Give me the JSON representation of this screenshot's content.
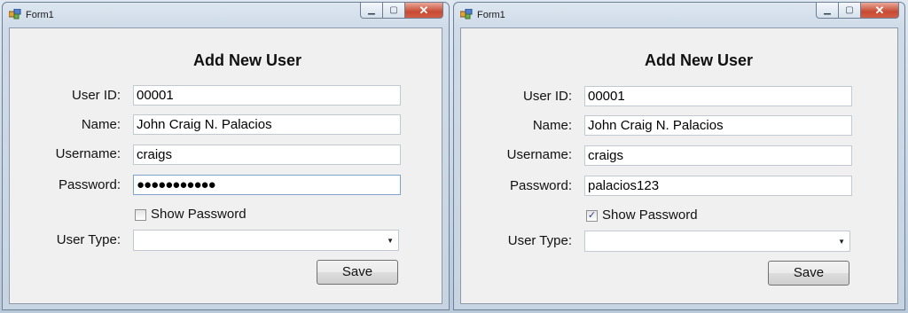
{
  "windows": [
    {
      "title": "Form1",
      "heading": "Add New User",
      "labels": {
        "user_id": "User ID:",
        "name": "Name:",
        "username": "Username:",
        "password": "Password:",
        "user_type": "User Type:"
      },
      "values": {
        "user_id": "00001",
        "name": "John Craig N. Palacios",
        "username": "craigs",
        "password": "●●●●●●●●●●●",
        "user_type": ""
      },
      "show_password": {
        "label": "Show Password",
        "checked": false
      },
      "save_label": "Save"
    },
    {
      "title": "Form1",
      "heading": "Add New User",
      "labels": {
        "user_id": "User ID:",
        "name": "Name:",
        "username": "Username:",
        "password": "Password:",
        "user_type": "User Type:"
      },
      "values": {
        "user_id": "00001",
        "name": "John Craig N. Palacios",
        "username": "craigs",
        "password": "palacios123",
        "user_type": ""
      },
      "show_password": {
        "label": "Show Password",
        "checked": true,
        "mark": "✓"
      },
      "save_label": "Save"
    }
  ]
}
